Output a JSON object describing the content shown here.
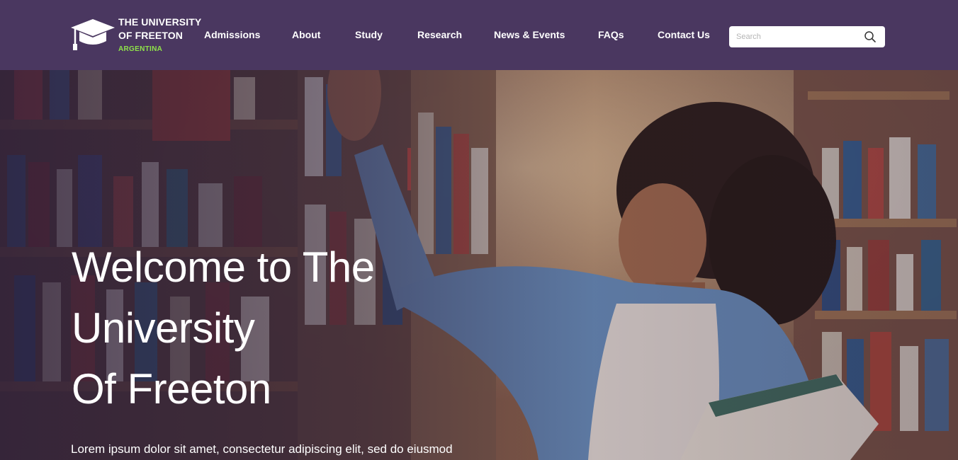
{
  "brand": {
    "line1": "THE UNIVERSITY",
    "line2": "OF FREETON",
    "country": "ARGENTINA",
    "logo_icon": "graduation-cap-icon",
    "accent_color": "#8fe24a",
    "header_color": "#4a3760"
  },
  "nav": {
    "items": [
      {
        "label": "Admissions"
      },
      {
        "label": "About"
      },
      {
        "label": "Study"
      },
      {
        "label": "Research"
      },
      {
        "label": "News & Events"
      },
      {
        "label": "FAQs"
      },
      {
        "label": "Contact Us"
      }
    ]
  },
  "search": {
    "placeholder": "Search",
    "icon": "search-icon"
  },
  "hero": {
    "title_line1": "Welcome to The",
    "title_line2": "University",
    "title_line3": "Of Freeton",
    "subtitle": "Lorem ipsum dolor sit amet, consectetur adipiscing elit, sed do eiusmod"
  }
}
